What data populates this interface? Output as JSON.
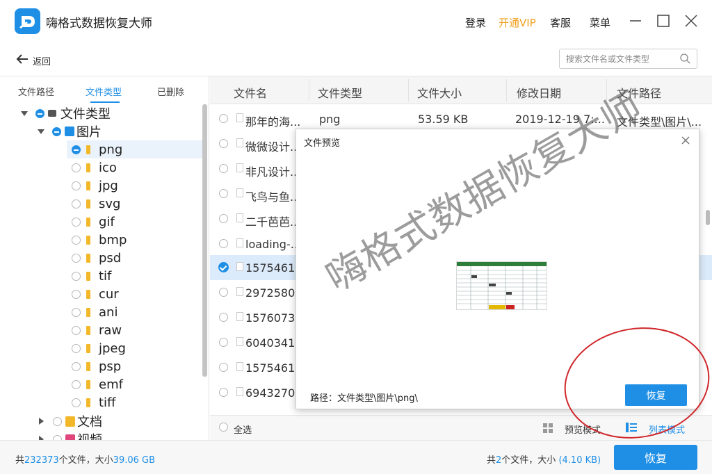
{
  "app": {
    "title": "嗨格式数据恢复大师",
    "brand_color": "#1f8fe6",
    "vip_color": "#f0a020"
  },
  "top_links": {
    "login": "登录",
    "vip": "开通VIP",
    "service": "客服",
    "menu": "菜单"
  },
  "back": {
    "label": "返回"
  },
  "search": {
    "placeholder": "搜索文件名或文件类型"
  },
  "left_tabs": [
    "文件路径",
    "文件类型",
    "已删除"
  ],
  "tree": {
    "root": "文件类型",
    "images": "图片",
    "image_types": [
      "png",
      "ico",
      "jpg",
      "svg",
      "gif",
      "bmp",
      "psd",
      "tif",
      "cur",
      "ani",
      "raw",
      "jpeg",
      "psp",
      "emf",
      "tiff"
    ],
    "docs": "文档",
    "video": "视频"
  },
  "table": {
    "columns": [
      "文件名",
      "文件类型",
      "文件大小",
      "修改日期",
      "文件路径"
    ],
    "rows": [
      {
        "name": "那年的海...",
        "type": "png",
        "size": "53.59 KB",
        "date": "2019-12-19 7:...",
        "path": "文件类型\\图片\\..."
      },
      {
        "name": "微微设计...",
        "checked": false
      },
      {
        "name": "非凡设计...",
        "checked": false
      },
      {
        "name": "飞鸟与鱼...",
        "checked": false
      },
      {
        "name": "二千芭芭...",
        "checked": false
      },
      {
        "name": "loading-...",
        "checked": false
      },
      {
        "name": "1575461...",
        "checked": true
      },
      {
        "name": "2972580...",
        "checked": false
      },
      {
        "name": "1576073...",
        "checked": false
      },
      {
        "name": "6040341...",
        "checked": false
      },
      {
        "name": "1575461...",
        "checked": false
      },
      {
        "name": "6943270...",
        "checked": false
      }
    ]
  },
  "table_footer": {
    "select_all": "全选",
    "preview_mode": "预览模式",
    "list_mode": "列表模式"
  },
  "status": {
    "total_prefix": "共",
    "total_count": "232373",
    "total_mid": "个文件，大小",
    "total_size": "39.06 GB",
    "sel_prefix": "共",
    "sel_count": "2",
    "sel_mid": "个文件，大小",
    "sel_size": "(4.10 KB)",
    "recover": "恢复"
  },
  "dialog": {
    "title": "文件预览",
    "path_label": "路径：",
    "path": "文件类型\\图片\\png\\",
    "recover": "恢复"
  },
  "watermark": "嗨格式数据恢复大师"
}
